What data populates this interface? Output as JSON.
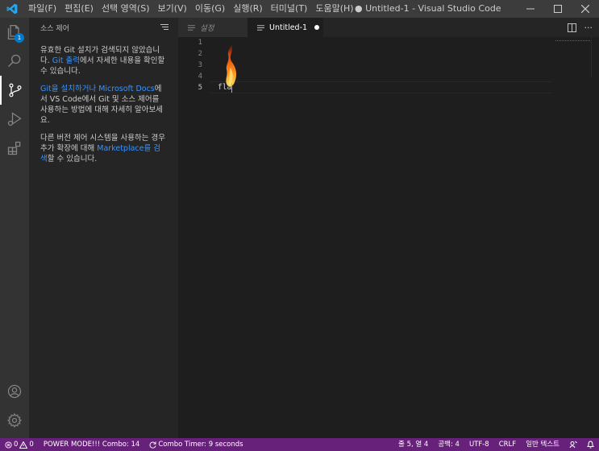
{
  "window": {
    "title": "● Untitled-1 - Visual Studio Code"
  },
  "menu": [
    "파일(F)",
    "편집(E)",
    "선택 영역(S)",
    "보기(V)",
    "이동(G)",
    "실행(R)",
    "터미널(T)",
    "도움말(H)"
  ],
  "activity": {
    "explorer_badge": "1"
  },
  "sidebar": {
    "title": "소스 제어",
    "p1_text_a": "유효한 Git 설치가 검색되지 않았습니다.",
    "p1_link": "Git 출력",
    "p1_text_b": "에서 자세한 내용을 확인할 수 있습니다.",
    "p2_link": "Git을 설치하거나 Microsoft Docs",
    "p2_text": "에서 VS Code에서 Git 및 소스 제어를 사용하는 방법에 대해 자세히 알아보세요.",
    "p3_text_a": "다른 버전 제어 시스템을 사용하는 경우 추가 확장에 대해",
    "p3_link": "Marketplace를 검색",
    "p3_text_b": "할 수 있습니다."
  },
  "tabs": [
    {
      "label": "설정",
      "active": false
    },
    {
      "label": "Untitled-1",
      "active": true,
      "dirty": true
    }
  ],
  "editor": {
    "line_numbers": [
      "1",
      "2",
      "3",
      "4",
      "5"
    ],
    "current_line": "5",
    "line5_text": "fla"
  },
  "statusbar": {
    "errors": "0",
    "warnings": "0",
    "power_mode": "POWER MODE!!! Combo: 14",
    "combo_timer": "Combo Timer: 9 seconds",
    "position": "줄 5, 열 4",
    "spaces": "공백: 4",
    "encoding": "UTF-8",
    "eol": "CRLF",
    "language": "일반 텍스트"
  },
  "colors": {
    "statusbar_bg": "#68217a",
    "link": "#3794ff",
    "badge": "#007acc",
    "activity_bar": "#333333",
    "sidebar": "#252526",
    "editor": "#1e1e1e"
  },
  "icons": [
    "vscode-logo-icon",
    "files-icon",
    "search-icon",
    "source-control-icon",
    "run-debug-icon",
    "extensions-icon",
    "account-icon",
    "settings-gear-icon",
    "flame-icon"
  ]
}
